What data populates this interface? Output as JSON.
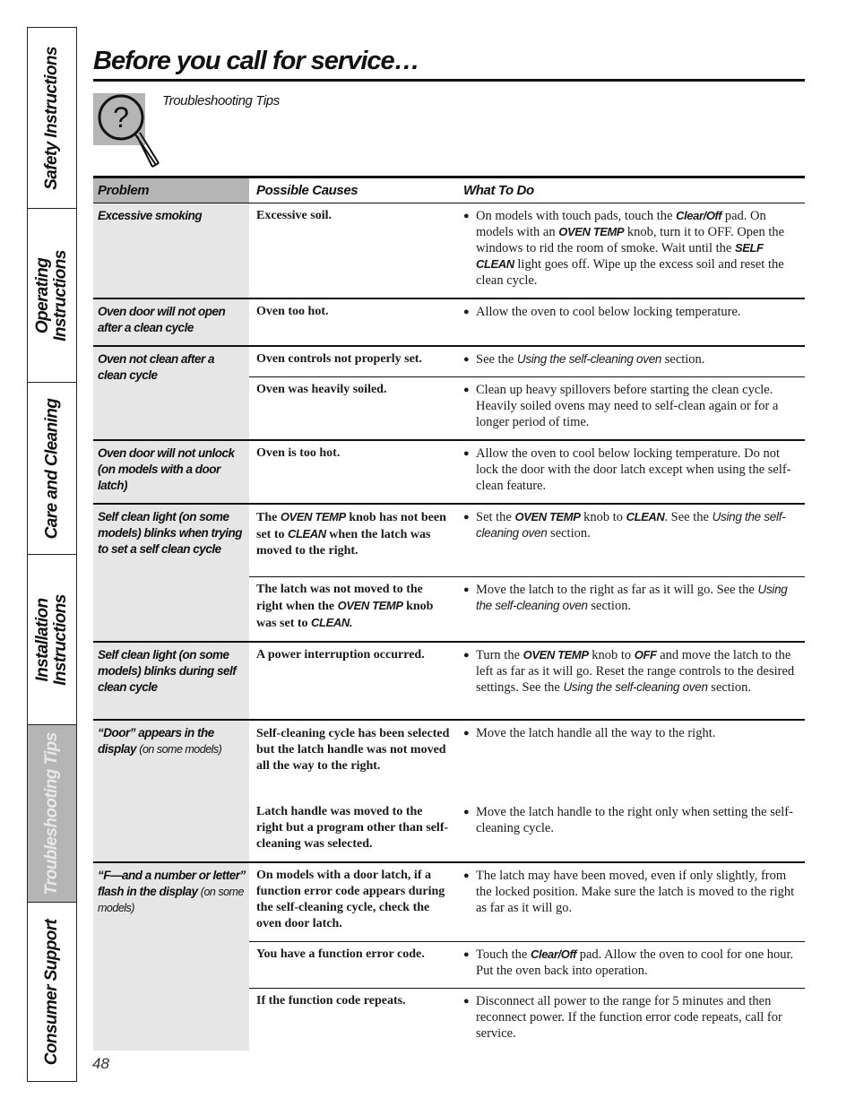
{
  "side_tabs": [
    {
      "label": "Safety Instructions",
      "active": false
    },
    {
      "label": "Operating Instructions",
      "line1": "Operating",
      "line2": "Instructions",
      "active": false
    },
    {
      "label": "Care and Cleaning",
      "active": false
    },
    {
      "label": "Installation Instructions",
      "line1": "Installation",
      "line2": "Instructions",
      "active": false
    },
    {
      "label": "Troubleshooting Tips",
      "active": true
    },
    {
      "label": "Consumer Support",
      "active": false
    }
  ],
  "header": {
    "title": "Before you call for service…",
    "subtitle": "Troubleshooting Tips",
    "icon": "magnifier-question-icon"
  },
  "table": {
    "columns": [
      "Problem",
      "Possible Causes",
      "What To Do"
    ],
    "rows": [
      {
        "problem": "Excessive smoking",
        "items": [
          {
            "cause": "Excessive soil.",
            "todo": [
              {
                "t": "On models with touch pads, touch the "
              },
              {
                "b": "Clear/Off"
              },
              {
                "t": " pad. On models with an "
              },
              {
                "b": "OVEN TEMP"
              },
              {
                "t": " knob, turn it to OFF. Open the windows to rid the room of smoke. Wait until the "
              },
              {
                "b": "SELF CLEAN"
              },
              {
                "t": " light goes off. Wipe up the excess soil and reset the clean cycle."
              }
            ]
          }
        ]
      },
      {
        "problem": "Oven door will not open after a clean cycle",
        "items": [
          {
            "cause": "Oven too hot.",
            "todo": [
              {
                "t": "Allow the oven to cool below locking temperature."
              }
            ]
          }
        ]
      },
      {
        "problem": "Oven not clean after a clean cycle",
        "items": [
          {
            "cause": "Oven controls not properly set.",
            "todo": [
              {
                "t": "See the "
              },
              {
                "i": "Using the self-cleaning oven"
              },
              {
                "t": " section."
              }
            ]
          },
          {
            "cause": "Oven was heavily soiled.",
            "todo": [
              {
                "t": "Clean up heavy spillovers before starting the clean cycle. Heavily soiled ovens may need to self-clean again or for a longer period of time."
              }
            ]
          }
        ]
      },
      {
        "problem": "Oven door will not unlock (on models with a door latch)",
        "items": [
          {
            "cause": "Oven is too hot.",
            "todo": [
              {
                "t": "Allow the oven to cool below locking temperature. Do not lock the door with the door latch except when using the self-clean feature."
              }
            ]
          }
        ]
      },
      {
        "problem": "Self clean light (on some models) blinks when trying to set a self clean cycle",
        "items": [
          {
            "cause_rich": [
              {
                "t": "The "
              },
              {
                "b": "OVEN TEMP"
              },
              {
                "t": " knob has not been set to "
              },
              {
                "b": "CLEAN"
              },
              {
                "t": " when the latch was moved to the right."
              }
            ],
            "todo": [
              {
                "t": "Set the "
              },
              {
                "b": "OVEN TEMP"
              },
              {
                "t": " knob to "
              },
              {
                "b": "CLEAN"
              },
              {
                "t": ". See the "
              },
              {
                "i": "Using the self-cleaning oven"
              },
              {
                "t": " section."
              }
            ]
          },
          {
            "cause_rich": [
              {
                "t": "The latch was not moved to the right when the "
              },
              {
                "b": "OVEN TEMP"
              },
              {
                "t": " knob was set to "
              },
              {
                "b": "CLEAN."
              }
            ],
            "todo": [
              {
                "t": "Move the latch to the right as far as it will go. See the "
              },
              {
                "i": "Using the self-cleaning oven"
              },
              {
                "t": " section."
              }
            ]
          }
        ]
      },
      {
        "problem": "Self clean light (on some models) blinks during self clean cycle",
        "items": [
          {
            "cause": "A power interruption occurred.",
            "todo": [
              {
                "t": "Turn the "
              },
              {
                "b": "OVEN TEMP"
              },
              {
                "t": " knob to "
              },
              {
                "b": "OFF"
              },
              {
                "t": " and move the latch to the left as far as it will go. Reset the range controls to the desired settings. See the "
              },
              {
                "i": "Using the self-cleaning oven"
              },
              {
                "t": " section."
              }
            ]
          }
        ]
      },
      {
        "problem": "“Door” appears in the display",
        "problem_note": "(on some models)",
        "items": [
          {
            "cause": "Self-cleaning cycle has been selected but the latch handle was not moved all the way to the right.",
            "todo": [
              {
                "t": "Move the latch handle all the way to the right."
              }
            ]
          },
          {
            "cause": "Latch handle was moved to the right but a program other than self-cleaning was selected.",
            "todo": [
              {
                "t": "Move the latch handle to the right only when setting the self-cleaning cycle."
              }
            ],
            "noline": true
          }
        ]
      },
      {
        "problem": "“F—and a number or letter” flash in the display",
        "problem_note": "(on some models)",
        "items": [
          {
            "cause": "On models with a door latch, if a function error code appears during the self-cleaning cycle, check the oven door latch.",
            "todo": [
              {
                "t": "The latch may have been moved, even if only slightly, from the locked position. Make sure the latch is moved to the right as far as it will go."
              }
            ]
          },
          {
            "cause": "You have a function error code.",
            "todo": [
              {
                "t": "Touch the "
              },
              {
                "b": "Clear/Off"
              },
              {
                "t": " pad. Allow the oven to cool for one hour. Put the oven back into operation."
              }
            ]
          },
          {
            "cause": "If the function code repeats.",
            "todo": [
              {
                "t": "Disconnect all power to the range for 5 minutes and then reconnect power. If the function error code repeats, call for service."
              }
            ]
          }
        ]
      }
    ]
  },
  "footer": {
    "page_number": "48"
  },
  "colors": {
    "tab_active": "#b5b5b5",
    "problem_bg": "#e6e6e6",
    "header_bg": "#b5b5b5",
    "rule": "#111111"
  }
}
